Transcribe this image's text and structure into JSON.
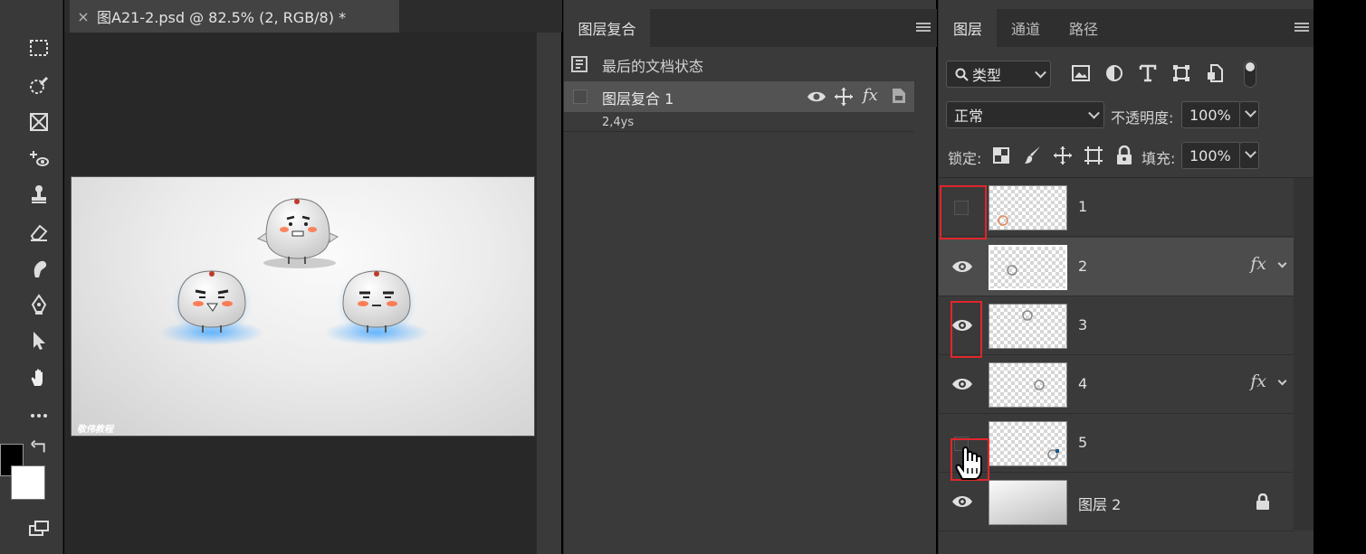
{
  "document": {
    "tab_close": "×",
    "tab_title": "图A21-2.psd @ 82.5% (2, RGB/8) *",
    "watermark": "敬伟教程"
  },
  "comps_panel": {
    "tab_label": "图层复合",
    "last_state_label": "最后的文档状态",
    "comp_name": "图层复合 1",
    "comp_note": "2,4ys",
    "comp_fx": "fx"
  },
  "layers_panel": {
    "tabs": [
      "图层",
      "通道",
      "路径"
    ],
    "filter_label": "类型",
    "blend_mode": "正常",
    "opacity_label": "不透明度:",
    "opacity_value": "100%",
    "lock_label": "锁定:",
    "fill_label": "填充:",
    "fill_value": "100%",
    "layers": [
      {
        "name": "1",
        "visible": false,
        "fx": ""
      },
      {
        "name": "2",
        "visible": true,
        "fx": "fx",
        "selected": true
      },
      {
        "name": "3",
        "visible": true,
        "fx": ""
      },
      {
        "name": "4",
        "visible": true,
        "fx": "fx"
      },
      {
        "name": "5",
        "visible": false,
        "fx": ""
      },
      {
        "name": "图层 2",
        "visible": true,
        "fx": "",
        "locked": true
      }
    ]
  },
  "colors": {
    "panel_bg": "#3a3a3a",
    "highlight": "#e0262a",
    "selected_row": "#4c4c4c"
  }
}
